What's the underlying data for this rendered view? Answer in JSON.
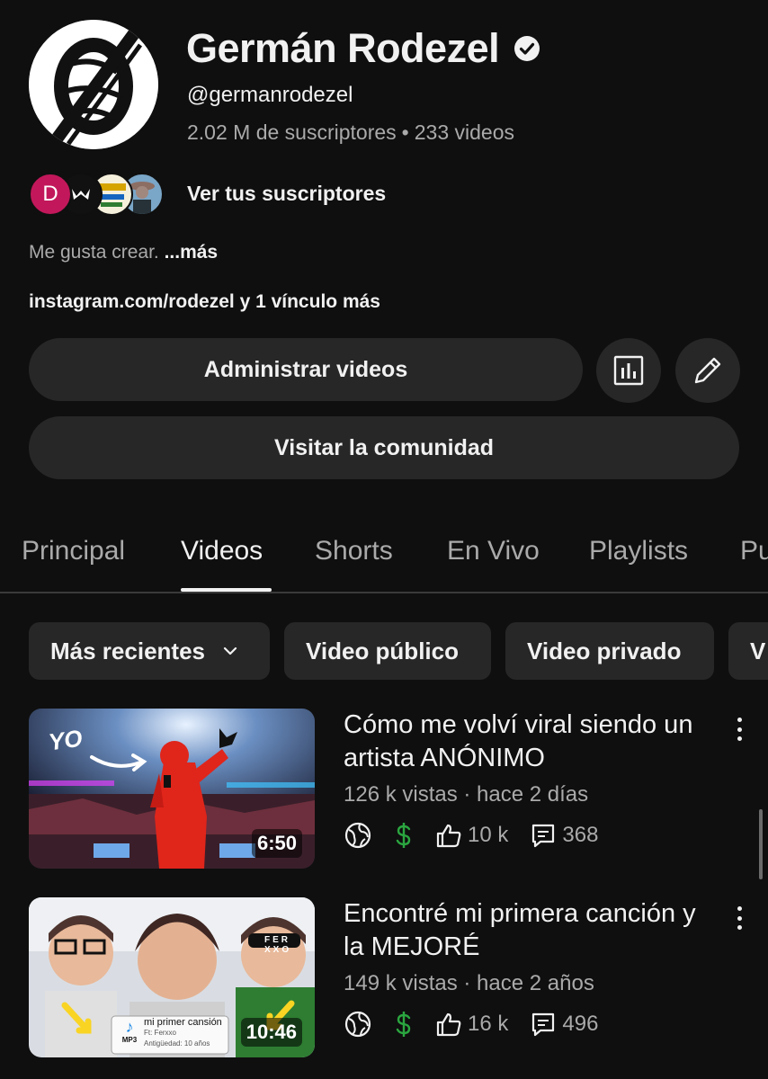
{
  "channel": {
    "name": "Germán Rodezel",
    "handle": "@germanrodezel",
    "subscribers": "2.02 M de suscriptores",
    "separator": "•",
    "video_count": "233 videos",
    "subscribers_link": "Ver tus suscriptores",
    "subscriber_avatar_initial": "D",
    "description": "Me gusta crear.",
    "description_more": "...más",
    "links_text": "instagram.com/rodezel y 1 vínculo más"
  },
  "actions": {
    "manage_videos": "Administrar videos",
    "visit_community": "Visitar la comunidad",
    "analytics_icon": "analytics-icon",
    "edit_icon": "pencil-icon"
  },
  "tabs": [
    {
      "label": "Principal",
      "active": false
    },
    {
      "label": "Videos",
      "active": true
    },
    {
      "label": "Shorts",
      "active": false
    },
    {
      "label": "En Vivo",
      "active": false
    },
    {
      "label": "Playlists",
      "active": false
    },
    {
      "label": "Pu",
      "active": false
    }
  ],
  "filters": {
    "sort": "Más recientes",
    "chips": [
      "Video público",
      "Video privado",
      "V"
    ]
  },
  "videos": [
    {
      "title": "Cómo me volví viral siendo un artista ANÓNIMO",
      "meta": "126 k vistas · hace 2 días",
      "duration": "6:50",
      "likes": "10 k",
      "comments": "368",
      "thumb_text": "YO"
    },
    {
      "title": "Encontré mi primera canción y la MEJORÉ",
      "meta": "149 k vistas · hace 2 años",
      "duration": "10:46",
      "likes": "16 k",
      "comments": "496",
      "thumb_text": "mi primer cansión",
      "thumb_sub1": "Ft: Ferxxo",
      "thumb_sub2": "Antigüedad: 10 años",
      "thumb_badge": "MP3",
      "thumb_glasses": "FER XXO"
    }
  ],
  "colors": {
    "background": "#0f0f0f",
    "surface": "#272727",
    "text_primary": "#f1f1f1",
    "text_secondary": "#aaaaaa",
    "monetization_green": "#2ba640"
  }
}
